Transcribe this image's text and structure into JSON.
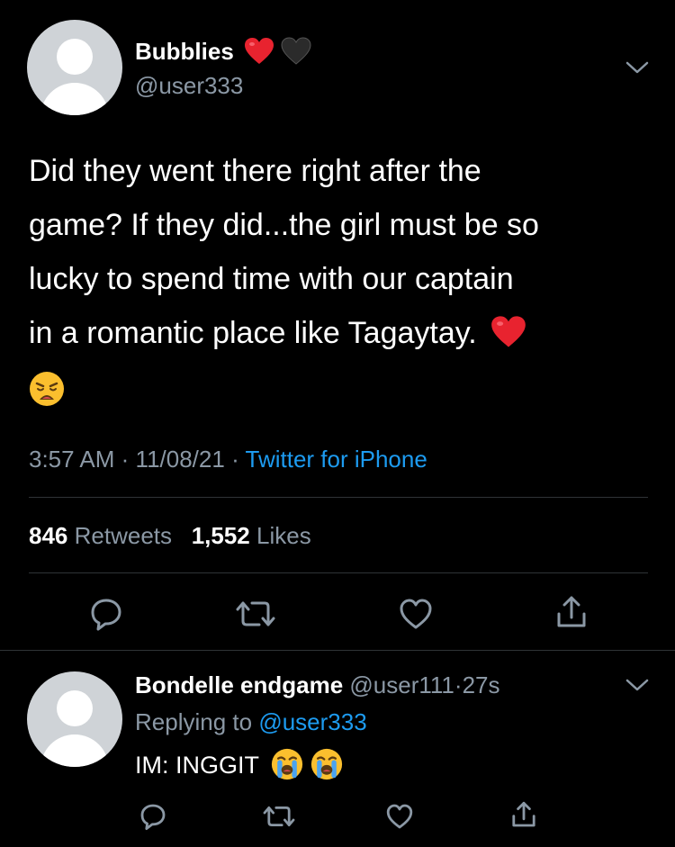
{
  "main_tweet": {
    "author": {
      "name": "Bubblies",
      "handle": "@user333",
      "name_emojis": [
        "red-heart-emoji",
        "black-heart-emoji"
      ]
    },
    "text_lines": [
      "Did they went there right after the",
      "game? If they did...the girl must be so",
      "lucky to spend time with our captain",
      "in a romantic place like Tagaytay."
    ],
    "text_emojis": [
      "red-heart-emoji",
      "weary-face-emoji"
    ],
    "time": "3:57 AM",
    "date": "11/08/21",
    "separator": "·",
    "source": "Twitter for iPhone",
    "retweets_count": "846",
    "retweets_label": "Retweets",
    "likes_count": "1,552",
    "likes_label": "Likes",
    "actions": [
      "reply-icon",
      "retweet-icon",
      "like-icon",
      "share-icon"
    ]
  },
  "reply": {
    "author": {
      "name": "Bondelle endgame",
      "handle": "@user111",
      "separator": "·",
      "time": "27s"
    },
    "replying_label": "Replying to",
    "replying_to": "@user333",
    "text": "IM: INGGIT",
    "text_emojis": [
      "loudly-crying-face-emoji",
      "loudly-crying-face-emoji"
    ],
    "actions": [
      "reply-icon",
      "retweet-icon",
      "like-icon",
      "share-icon"
    ]
  },
  "colors": {
    "background": "#000000",
    "text": "#ffffff",
    "secondary": "#8b98a5",
    "link": "#1d9bf0",
    "divider": "#2f3336"
  }
}
